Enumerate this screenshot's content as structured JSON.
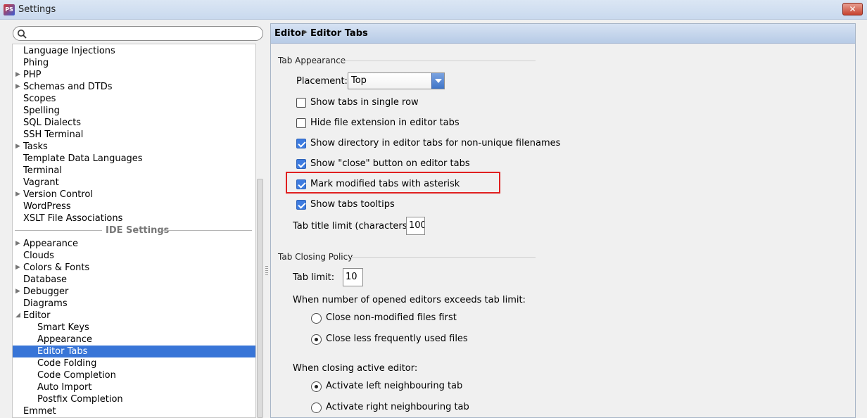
{
  "window": {
    "title": "Settings",
    "app_icon": "PS",
    "close_glyph": "✕"
  },
  "search": {
    "placeholder": ""
  },
  "tree": {
    "items_top": [
      {
        "label": "Language Injections",
        "expandable": false
      },
      {
        "label": "Phing",
        "expandable": false
      },
      {
        "label": "PHP",
        "expandable": true
      },
      {
        "label": "Schemas and DTDs",
        "expandable": true
      },
      {
        "label": "Scopes",
        "expandable": false
      },
      {
        "label": "Spelling",
        "expandable": false
      },
      {
        "label": "SQL Dialects",
        "expandable": false
      },
      {
        "label": "SSH Terminal",
        "expandable": false
      },
      {
        "label": "Tasks",
        "expandable": true
      },
      {
        "label": "Template Data Languages",
        "expandable": false
      },
      {
        "label": "Terminal",
        "expandable": false
      },
      {
        "label": "Vagrant",
        "expandable": false
      },
      {
        "label": "Version Control",
        "expandable": true
      },
      {
        "label": "WordPress",
        "expandable": false
      },
      {
        "label": "XSLT File Associations",
        "expandable": false
      }
    ],
    "section_header": "IDE Settings",
    "items_bottom": [
      {
        "label": "Appearance",
        "expandable": true,
        "child": false
      },
      {
        "label": "Clouds",
        "expandable": false,
        "child": false
      },
      {
        "label": "Colors & Fonts",
        "expandable": true,
        "child": false
      },
      {
        "label": "Database",
        "expandable": false,
        "child": false
      },
      {
        "label": "Debugger",
        "expandable": true,
        "child": false
      },
      {
        "label": "Diagrams",
        "expandable": false,
        "child": false
      },
      {
        "label": "Editor",
        "expandable": true,
        "expanded": true,
        "child": false
      },
      {
        "label": "Smart Keys",
        "expandable": false,
        "child": true
      },
      {
        "label": "Appearance",
        "expandable": false,
        "child": true
      },
      {
        "label": "Editor Tabs",
        "expandable": false,
        "child": true,
        "selected": true
      },
      {
        "label": "Code Folding",
        "expandable": false,
        "child": true
      },
      {
        "label": "Code Completion",
        "expandable": false,
        "child": true
      },
      {
        "label": "Auto Import",
        "expandable": false,
        "child": true
      },
      {
        "label": "Postfix Completion",
        "expandable": false,
        "child": true
      },
      {
        "label": "Emmet",
        "expandable": false,
        "child": false
      }
    ]
  },
  "breadcrumb": {
    "parent": "Editor",
    "current": "Editor Tabs"
  },
  "tab_appearance": {
    "group_title": "Tab Appearance",
    "placement_label": "Placement:",
    "placement_value": "Top",
    "checkboxes": [
      {
        "label": "Show tabs in single row",
        "checked": false
      },
      {
        "label": "Hide file extension in editor tabs",
        "checked": false
      },
      {
        "label": "Show directory in editor tabs for non-unique filenames",
        "checked": true
      },
      {
        "label": "Show \"close\" button on editor tabs",
        "checked": true
      },
      {
        "label": "Mark modified tabs with asterisk",
        "checked": true,
        "highlighted": true
      },
      {
        "label": "Show tabs tooltips",
        "checked": true
      }
    ],
    "title_limit_label": "Tab title limit (characters):",
    "title_limit_value": "100"
  },
  "tab_closing": {
    "group_title": "Tab Closing Policy",
    "tab_limit_label": "Tab limit:",
    "tab_limit_value": "10",
    "exceeds_label": "When number of opened editors exceeds tab limit:",
    "exceeds_options": [
      {
        "label": "Close non-modified files first",
        "checked": false
      },
      {
        "label": "Close less frequently used files",
        "checked": true
      }
    ],
    "closing_label": "When closing active editor:",
    "closing_options": [
      {
        "label": "Activate left neighbouring tab",
        "checked": true
      },
      {
        "label": "Activate right neighbouring tab",
        "checked": false
      }
    ]
  },
  "colors": {
    "selection": "#3875d7",
    "highlight_border": "#e02020",
    "checkbox_checked": "#3d7be0"
  }
}
